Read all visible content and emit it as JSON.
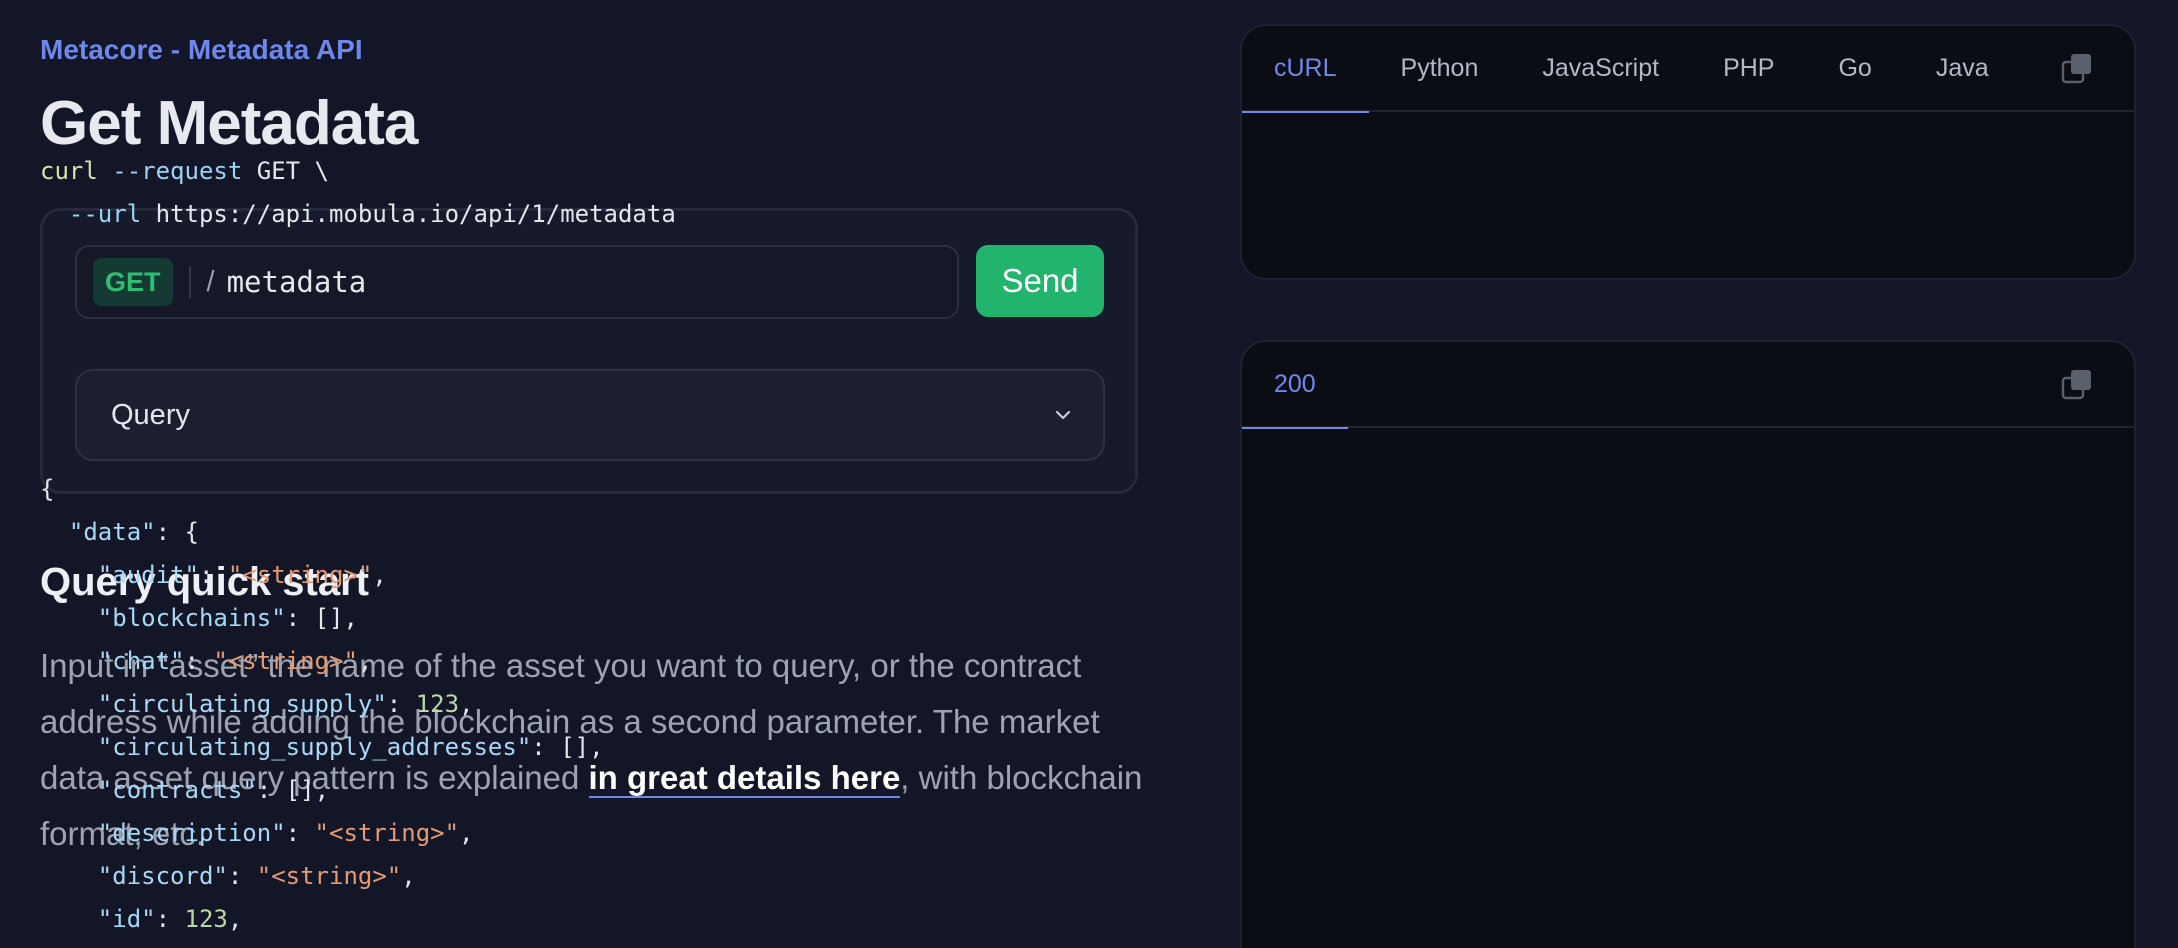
{
  "header": {
    "eyebrow": "Metacore - Metadata API",
    "title": "Get Metadata"
  },
  "playground": {
    "method": "GET",
    "slash": "/",
    "path": "metadata",
    "send_label": "Send",
    "query_label": "Query"
  },
  "quickstart": {
    "heading": "Query quick start",
    "body_before": "Input in “asset” the name of the asset you want to query, or the contract address while adding the blockchain as a second parameter. The market data asset query pattern is explained ",
    "link_text": "in great details here",
    "body_after": ", with blockchain format, etc."
  },
  "request_panel": {
    "tabs": [
      "cURL",
      "Python",
      "JavaScript",
      "PHP",
      "Go",
      "Java"
    ],
    "active_tab": "cURL",
    "line1_cmd": "curl",
    "line1_flag": "--request",
    "line1_rest": " GET \\",
    "line2_flag": "--url",
    "line2_url": "https://api.mobula.io/api/1/metadata"
  },
  "response_panel": {
    "status_tab": "200",
    "open_brace": "{",
    "data_key": "\"data\"",
    "data_open": ": {",
    "fields": [
      {
        "key": "\"audit\"",
        "value": "\"<string>\"",
        "type": "str"
      },
      {
        "key": "\"blockchains\"",
        "value": "[]",
        "type": "plain"
      },
      {
        "key": "\"chat\"",
        "value": "\"<string>\"",
        "type": "str"
      },
      {
        "key": "\"circulating_supply\"",
        "value": "123",
        "type": "num"
      },
      {
        "key": "\"circulating_supply_addresses\"",
        "value": "[]",
        "type": "plain"
      },
      {
        "key": "\"contracts\"",
        "value": "[]",
        "type": "plain"
      },
      {
        "key": "\"description\"",
        "value": "\"<string>\"",
        "type": "str"
      },
      {
        "key": "\"discord\"",
        "value": "\"<string>\"",
        "type": "str"
      },
      {
        "key": "\"id\"",
        "value": "123",
        "type": "num"
      }
    ]
  },
  "icons": {
    "copy": "copy-icon",
    "chevron": "chevron-down-icon"
  },
  "colors": {
    "accent": "#6f86ea",
    "send": "#22b46d",
    "get_badge": "#2cbf73"
  }
}
